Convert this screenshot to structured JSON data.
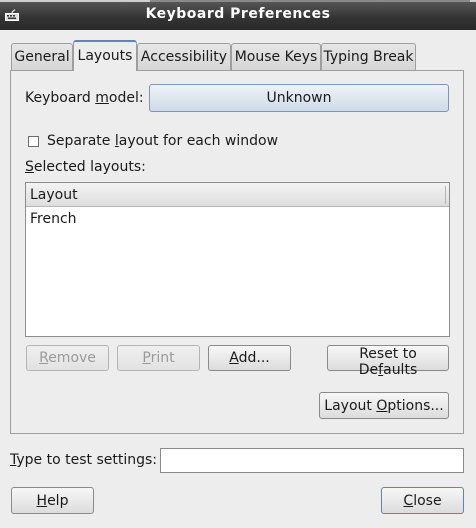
{
  "window": {
    "title": "Keyboard Preferences",
    "icon": "keyboard-icon"
  },
  "tabs": [
    {
      "label": "General",
      "active": false
    },
    {
      "label": "Layouts",
      "active": true
    },
    {
      "label": "Accessibility",
      "active": false
    },
    {
      "label": "Mouse Keys",
      "active": false
    },
    {
      "label": "Typing Break",
      "active": false
    }
  ],
  "layouts_tab": {
    "keyboard_model_label_pre": "Keyboard ",
    "keyboard_model_label_mnemonic": "m",
    "keyboard_model_label_post": "odel:",
    "keyboard_model_value": "Unknown",
    "separate_layout_label_pre": "Separate ",
    "separate_layout_label_mnemonic": "l",
    "separate_layout_label_post": "ayout for each window",
    "separate_layout_checked": false,
    "selected_layouts_mnemonic": "S",
    "selected_layouts_post": "elected layouts:",
    "layouts_column_header": "Layout",
    "layouts": [
      "French"
    ],
    "remove_mnemonic": "R",
    "remove_post": "emove",
    "print_mnemonic": "P",
    "print_post": "rint",
    "add_mnemonic": "A",
    "add_post": "dd...",
    "reset_pre": "Reset to De",
    "reset_mnemonic": "f",
    "reset_post": "aults",
    "layout_options_pre": "Layout ",
    "layout_options_mnemonic": "O",
    "layout_options_post": "ptions..."
  },
  "test_settings": {
    "label_mnemonic": "T",
    "label_post": "ype to test settings:",
    "value": ""
  },
  "footer": {
    "help_mnemonic": "H",
    "help_post": "elp",
    "close_mnemonic": "C",
    "close_post": "lose"
  },
  "colors": {
    "titlebar": "#333333",
    "window_bg": "#ededed",
    "active_tab_accent": "#5b86c0"
  }
}
